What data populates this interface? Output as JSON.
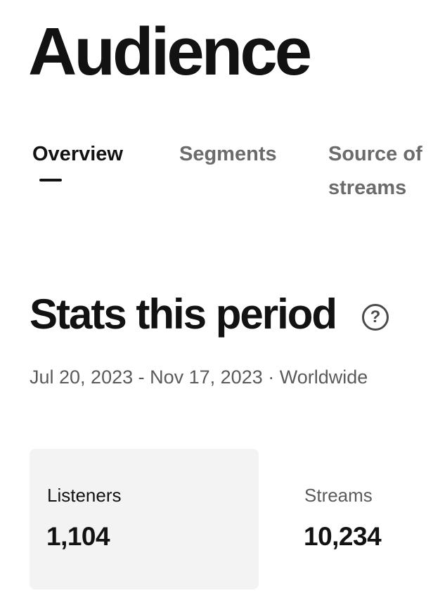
{
  "header": {
    "title": "Audience"
  },
  "tabs": [
    {
      "label": "Overview",
      "active": true
    },
    {
      "label": "Segments",
      "active": false
    },
    {
      "label": "Source of streams",
      "active": false
    }
  ],
  "stats": {
    "title": "Stats this period",
    "help_icon": "question-circle-icon",
    "period": "Jul 20, 2023 - Nov 17, 2023 · Worldwide",
    "cards": [
      {
        "label": "Listeners",
        "value": "1,104",
        "selected": true
      },
      {
        "label": "Streams",
        "value": "10,234",
        "selected": false
      }
    ]
  },
  "colors": {
    "text_primary": "#121212",
    "text_secondary": "#6b6b6b",
    "card_selected_bg": "#f3f3f3"
  }
}
